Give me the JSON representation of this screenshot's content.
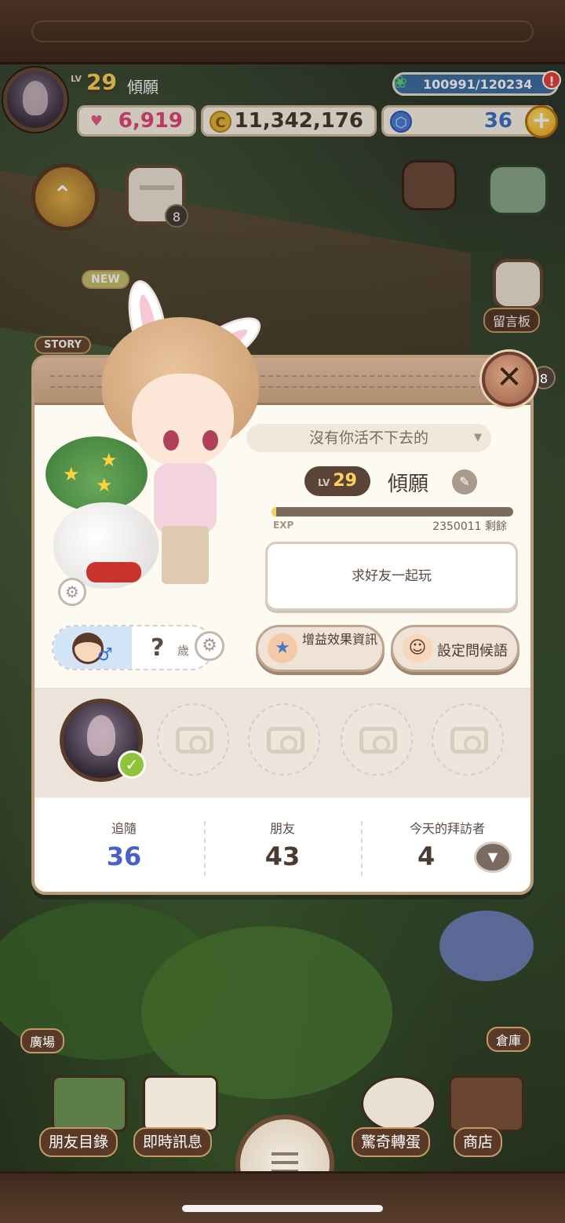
{
  "hud": {
    "level_prefix": "LV",
    "level": "29",
    "name": "傾願",
    "energy": "100991/120234",
    "alert": "!",
    "hearts": "6,919",
    "coins": "11,342,176",
    "gems": "36",
    "plus": "+"
  },
  "side": {
    "story_label": "STORY",
    "new_label": "NEW",
    "calendar_badge": "8",
    "guestbook_label": "留言板",
    "guestbook_badge": "8",
    "plaza_label": "廣場",
    "warehouse_label": "倉庫"
  },
  "profile": {
    "status": "沒有你活不下去的",
    "level_prefix": "LV",
    "level": "29",
    "name": "傾願",
    "exp_label": "EXP",
    "exp_remaining": "2350011 剩餘",
    "exp_fraction": 0.02,
    "greeting": "求好友一起玩",
    "age": "?",
    "age_unit": "歲",
    "buff_button": "增益效果資訊",
    "greeting_button": "設定問候語",
    "close": "✕"
  },
  "stats": {
    "following_label": "追隨",
    "following": "36",
    "friends_label": "朋友",
    "friends": "43",
    "visitors_label": "今天的拜訪者",
    "visitors": "4"
  },
  "nav": {
    "friend_list": "朋友目錄",
    "messages": "即時訊息",
    "gacha": "驚奇轉蛋",
    "shop": "商店"
  },
  "colors": {
    "accent_gold": "#ffd35a",
    "following_blue": "#4a5fc7",
    "panel_bg": "#fdfaf2"
  }
}
